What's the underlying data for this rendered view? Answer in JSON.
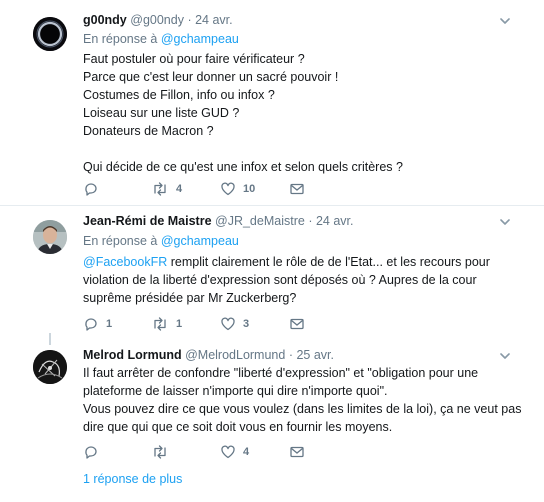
{
  "tweets": [
    {
      "name": "g00ndy",
      "handle": "@g00ndy",
      "dot": "·",
      "time": "24 avr.",
      "reply_prefix": "En réponse à",
      "reply_to": "@gchampeau",
      "lines": [
        "Faut postuler où pour faire vérificateur ?",
        "Parce que c'est leur donner un sacré pouvoir !",
        "Costumes de Fillon, info ou infox ?",
        "Loiseau sur une liste GUD ?",
        "Donateurs de Macron ?",
        "",
        "Qui décide de ce qu'est une infox et selon quels critères ?"
      ],
      "reply_count": "",
      "retweet_count": "4",
      "like_count": "10"
    },
    {
      "name": "Jean-Rémi de Maistre",
      "handle": "@JR_deMaistre",
      "dot": "·",
      "time": "24 avr.",
      "reply_prefix": "En réponse à",
      "reply_to": "@gchampeau",
      "line1_mention": "@FacebookFR",
      "line1_rest": " remplit clairement le rôle de de l'Etat... et les recours pour",
      "lines": [
        "violation de la liberté d'expression sont déposés où ? Aupres de la cour",
        "suprême présidée par Mr Zuckerberg?"
      ],
      "reply_count": "1",
      "retweet_count": "1",
      "like_count": "3"
    },
    {
      "name": "Melrod Lormund",
      "handle": "@MelrodLormund",
      "dot": "·",
      "time": "25 avr.",
      "lines": [
        "Il faut arrêter de confondre \"liberté d'expression\" et \"obligation pour une",
        "plateforme de laisser n'importe qui dire n'importe quoi\".",
        "Vous pouvez dire ce que vous voulez (dans les limites de la loi), ça ne veut pas",
        "dire que qui que ce soit doit vous en fournir les moyens."
      ],
      "reply_count": "",
      "retweet_count": "",
      "like_count": "4"
    }
  ],
  "more_replies": "1 réponse de plus",
  "colors": {
    "accent": "#1da1f2",
    "muted": "#657786",
    "text": "#14171a",
    "divider": "#e6ecf0"
  },
  "icons": [
    "chevron-down-icon",
    "reply-icon",
    "retweet-icon",
    "heart-icon",
    "message-icon"
  ]
}
